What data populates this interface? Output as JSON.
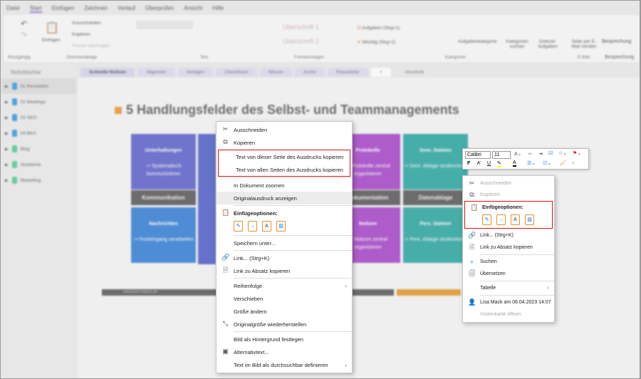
{
  "menubar": [
    "Datei",
    "Start",
    "Einfügen",
    "Zeichnen",
    "Verlauf",
    "Überprüfen",
    "Ansicht",
    "Hilfe"
  ],
  "ribbon": {
    "cut": "Ausschneiden",
    "copy": "Kopieren",
    "format": "Format übertragen",
    "paste": "Einfügen",
    "h1": "Überschrift 1",
    "h2": "Überschrift 2",
    "tag1": "Aufgaben (Strg+1)",
    "tag2": "Wichtig (Strg+2)",
    "tagcat": "Aufgabenkategorie",
    "findtags": "Kategorien suchen",
    "outlook": "Outlook-Aufgaben",
    "email": "Seite per E-Mail senden",
    "meeting": "Besprechung",
    "groups": [
      "Rückgängig",
      "Zwischenablage",
      "Text",
      "Formatvorlagen",
      "Kategorien",
      "E-Mail",
      "Besprechung"
    ]
  },
  "sidebar": {
    "title": "Notizbücher",
    "items": [
      {
        "label": "01 Persönlich",
        "color": "#1e8fd6"
      },
      {
        "label": "02 Meetings",
        "color": "#1e8fd6"
      },
      {
        "label": "03 SEO",
        "color": "#1e8fd6"
      },
      {
        "label": "04 BKA",
        "color": "#1e8fd6"
      },
      {
        "label": "Blog",
        "color": "#3cc48a"
      },
      {
        "label": "Akademie",
        "color": "#3cc48a"
      },
      {
        "label": "Marketing",
        "color": "#3cc48a"
      }
    ]
  },
  "tabs": [
    "Schnelle Notizen",
    "Allgemein",
    "Vorlagen",
    "Checklisten",
    "Wissen",
    "Archiv",
    "Passwörter",
    "+"
  ],
  "section_label": "Abschnitt",
  "slide": {
    "title": "5 Handlungsfelder des Selbst- und Teammanagements",
    "top": [
      {
        "t": "Unterhaltungen",
        "s": "-> Systematisch kommunizieren",
        "c": "#4a4fc4"
      },
      {
        "t": "Protokolle",
        "s": "-> Protokolle zentral organisieren",
        "c": "#9a2fc0"
      },
      {
        "t": "Gem. Dateien",
        "s": "-> Gem. Ablage strukturieren",
        "c": "#139a95"
      }
    ],
    "bands": [
      "Kommunikation",
      "Dokumentation",
      "Datenablage"
    ],
    "bottom": [
      {
        "t": "Nachrichten",
        "s": "-> Posteingang verarbeiten",
        "c": "#1c6fd0"
      },
      {
        "t": "Notizen",
        "s": "-> Notizen zentral organisieren",
        "c": "#9a2fc0"
      },
      {
        "t": "Pers. Dateien",
        "s": "-> Pers. Ablage strukturieren",
        "c": "#139a95"
      }
    ],
    "footer": "www.buero-kaizen.de"
  },
  "menu1": {
    "cut": "Ausschneiden",
    "copy": "Kopieren",
    "copy_this": "Text von dieser Seite des Ausdrucks kopieren",
    "copy_all": "Text von allen Seiten des Ausdrucks kopieren",
    "zoom": "In Dokument zoomen",
    "orig": "Originalausdruck anzeigen",
    "paste_opts": "Einfügeoptionen:",
    "save_as": "Speichern unter...",
    "link": "Link...  (Strg+K)",
    "link_para": "Link zu Absatz kopieren",
    "order": "Reihenfolge",
    "move": "Verschieben",
    "resize": "Größe ändern",
    "restore": "Originalgröße wiederherstellen",
    "bg": "Bild als Hintergrund festlegen",
    "alt": "Alternativtext...",
    "ocr": "Text im Bild als durchsuchbar definieren"
  },
  "minitoolbar": {
    "font": "Calibri",
    "size": "11",
    "bold": "F",
    "italic": "K",
    "underline": "U"
  },
  "menu2": {
    "cut": "Ausschneiden",
    "copy": "Kopieren",
    "paste_opts": "Einfügeoptionen:",
    "link": "Link...  (Strg+K)",
    "link_para": "Link zu Absatz kopieren",
    "search": "Suchen",
    "translate": "Übersetzen",
    "table": "Tabelle",
    "author": "Lisa Mack am 06.04.2023 14:07",
    "card": "Visitenkarte öffnen"
  },
  "colors": {
    "highlight": "#e01010",
    "accent": "#8a5cc6"
  }
}
